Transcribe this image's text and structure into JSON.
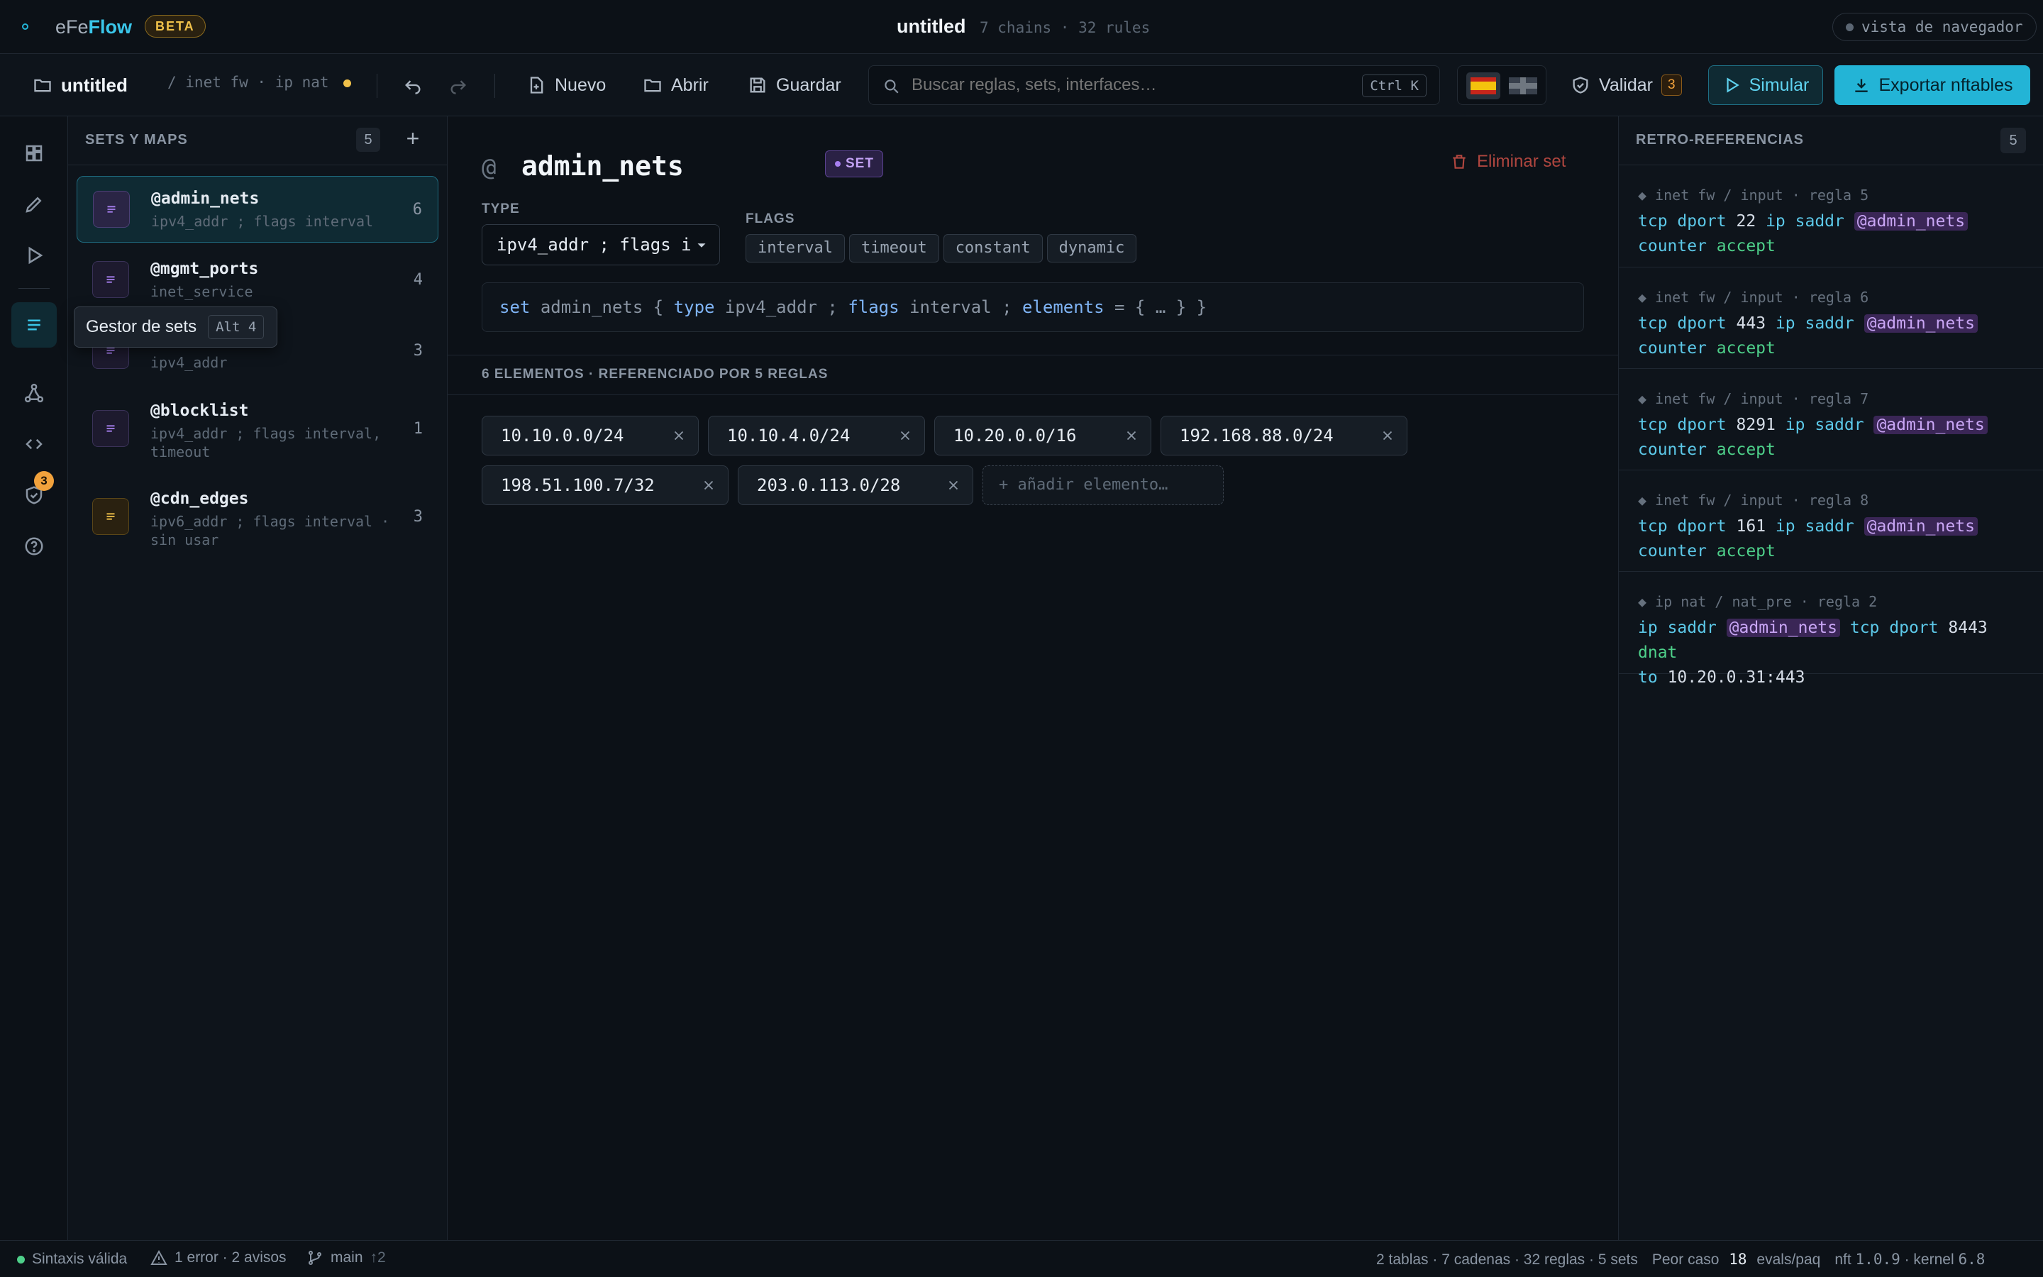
{
  "app": {
    "name_prefix": "eFe",
    "name_suffix": "Flow",
    "beta": "BETA"
  },
  "title": {
    "name": "untitled",
    "meta": "7 chains · 32 rules"
  },
  "browser_mode": "vista de navegador",
  "toolbar": {
    "project": "untitled",
    "path": "/ inet fw · ip nat",
    "nuevo": "Nuevo",
    "abrir": "Abrir",
    "guardar": "Guardar",
    "search_placeholder": "Buscar reglas, sets, interfaces…",
    "search_shortcut": "Ctrl K",
    "validar": "Validar",
    "validar_count": "3",
    "simular": "Simular",
    "exportar": "Exportar nftables"
  },
  "rail": {
    "badge": "3",
    "tooltip": "Gestor de sets",
    "tooltip_key": "Alt 4"
  },
  "sets_panel": {
    "title": "SETS Y MAPS",
    "count": "5",
    "items": [
      {
        "name": "@admin_nets",
        "sub": "ipv4_addr ; flags interval",
        "count": "6"
      },
      {
        "name": "@mgmt_ports",
        "sub": "inet_service",
        "count": "4"
      },
      {
        "name": "",
        "sub": "ipv4_addr",
        "count": "3"
      },
      {
        "name": "@blocklist",
        "sub": "ipv4_addr ; flags interval, timeout",
        "count": "1"
      },
      {
        "name": "@cdn_edges",
        "sub": "ipv6_addr ; flags interval · sin usar",
        "count": "3"
      }
    ]
  },
  "editor": {
    "at": "@",
    "name": "admin_nets",
    "badge": "SET",
    "delete": "Eliminar set",
    "type_label": "TYPE",
    "type_value": "ipv4_addr ; flags i",
    "flags_label": "FLAGS",
    "flags": [
      "interval",
      "timeout",
      "constant",
      "dynamic"
    ],
    "code": {
      "k1": "set",
      "name": "admin_nets",
      "b1": "{",
      "k2": "type",
      "t": "ipv4_addr",
      "semi1": ";",
      "k3": "flags",
      "f": "interval",
      "semi2": ";",
      "k4": "elements",
      "rest": "= { … } }"
    },
    "elements_heading": "6 ELEMENTOS · REFERENCIADO POR 5 REGLAS",
    "elements": [
      "10.10.0.0/24",
      "10.10.4.0/24",
      "10.20.0.0/16",
      "192.168.88.0/24",
      "198.51.100.7/32",
      "203.0.113.0/28"
    ],
    "add_placeholder": "+ añadir elemento…"
  },
  "refs": {
    "title": "RETRO-REFERENCIAS",
    "count": "5",
    "items": [
      {
        "header": "◆ inet fw / input · regla 5",
        "port": "22"
      },
      {
        "header": "◆ inet fw / input · regla 6",
        "port": "443"
      },
      {
        "header": "◆ inet fw / input · regla 7",
        "port": "8291"
      },
      {
        "header": "◆ inet fw / input · regla 8",
        "port": "161"
      }
    ],
    "nat": {
      "header": "◆ ip nat / nat_pre · regla 2",
      "port": "8443",
      "target": "10.20.0.31:443"
    },
    "w_tcp": "tcp",
    "w_dport": "dport",
    "w_ip": "ip",
    "w_saddr": "saddr",
    "w_set": "@admin_nets",
    "w_counter": "counter",
    "w_accept": "accept",
    "w_dnat": "dnat",
    "w_to": "to"
  },
  "status": {
    "syntax": "Sintaxis válida",
    "errors": "1 error · 2 avisos",
    "branch": "main",
    "branch_ahead": "↑2",
    "summary": "2 tablas · 7 cadenas · 32 reglas · 5 sets",
    "worst_label": "Peor caso",
    "worst_value": "18",
    "worst_unit": "evals/paq",
    "nft_label": "nft",
    "nft_version": "1.0.9",
    "kernel_label": "· kernel",
    "kernel_version": "6.8"
  },
  "colors": {
    "accent": "#23b4d6",
    "purple": "#a77ff0",
    "orange": "#f2a23c",
    "green": "#4ed08a",
    "danger": "#c0453f"
  }
}
